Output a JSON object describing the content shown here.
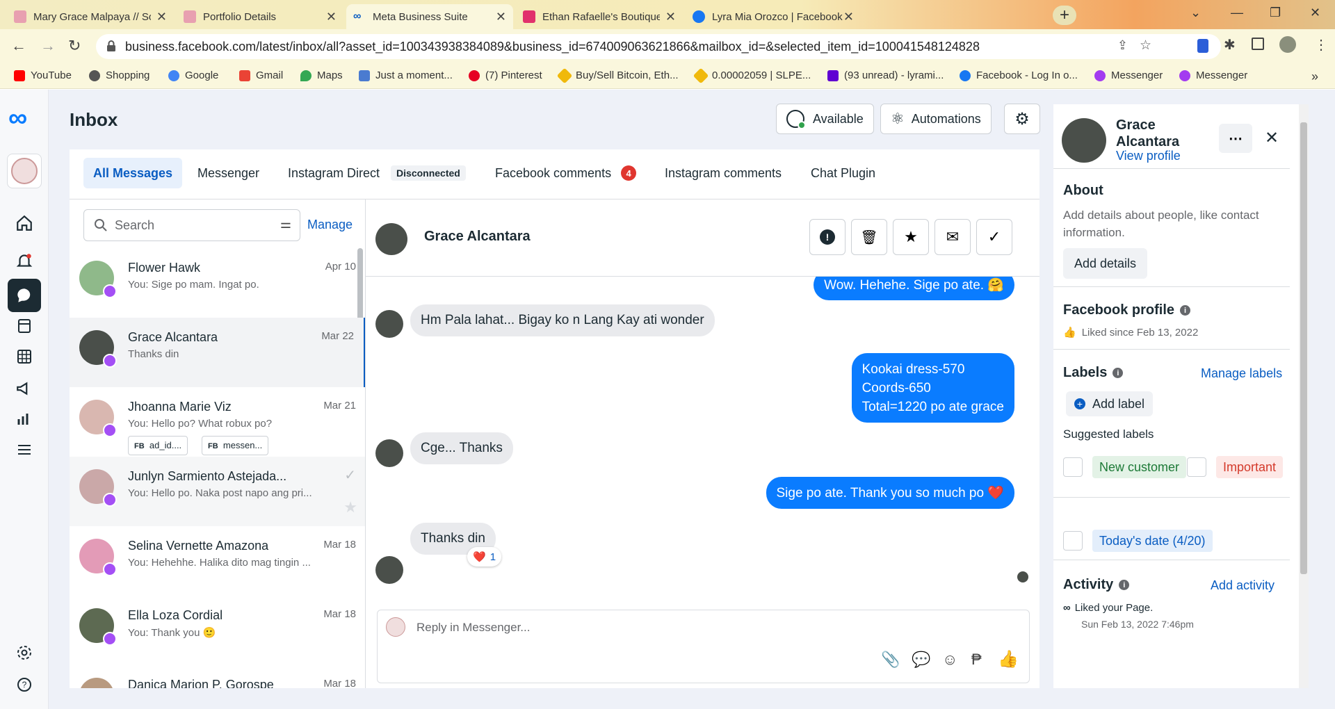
{
  "browser": {
    "tabs": [
      {
        "title": "Mary Grace Malpaya // Social Me",
        "fav": "#e8a0b0"
      },
      {
        "title": "Portfolio Details",
        "fav": "#e8a0b0"
      },
      {
        "title": "Meta Business Suite",
        "fav": "#0a5dc2"
      },
      {
        "title": "Ethan Rafaelle's Boutique (@etha",
        "fav": "#e1306c"
      },
      {
        "title": "Lyra Mia Orozco | Facebook",
        "fav": "#1877f2"
      }
    ],
    "url": "business.facebook.com/latest/inbox/all?asset_id=100343938384089&business_id=674009063621866&mailbox_id=&selected_item_id=100041548124828",
    "bookmarks": [
      "YouTube",
      "Shopping",
      "Google",
      "Gmail",
      "Maps",
      "Just a moment...",
      "(7) Pinterest",
      "Buy/Sell Bitcoin, Eth...",
      "0.00002059 | SLPE...",
      "(93 unread) - lyrami...",
      "Facebook - Log In o...",
      "Messenger",
      "Messenger"
    ]
  },
  "header": {
    "title": "Inbox",
    "available": "Available",
    "automations": "Automations"
  },
  "tabs": {
    "all": "All Messages",
    "messenger": "Messenger",
    "instagram_direct": "Instagram Direct",
    "disconnected": "Disconnected",
    "fb_comments": "Facebook comments",
    "fb_comments_count": "4",
    "ig_comments": "Instagram comments",
    "chat_plugin": "Chat Plugin"
  },
  "list": {
    "search_placeholder": "Search",
    "manage": "Manage",
    "conversations": [
      {
        "name": "Flower Hawk",
        "preview": "You: Sige po mam. Ingat po.",
        "date": "Apr 10"
      },
      {
        "name": "Grace Alcantara",
        "preview": "Thanks din",
        "date": "Mar 22"
      },
      {
        "name": "Jhoanna Marie Viz",
        "preview": "You: Hello po? What robux po?",
        "date": "Mar 21",
        "tags": [
          "ad_id....",
          "messen..."
        ]
      },
      {
        "name": "Junlyn Sarmiento Astejada...",
        "preview": "You: Hello po. Naka post napo ang pri...",
        "date": ""
      },
      {
        "name": "Selina Vernette Amazona",
        "preview": "You: Hehehhe. Halika dito mag tingin ...",
        "date": "Mar 18"
      },
      {
        "name": "Ella Loza Cordial",
        "preview": "You: Thank you 🙂",
        "date": "Mar 18"
      },
      {
        "name": "Danica Marion P. Gorospe",
        "preview": "",
        "date": "Mar 18"
      }
    ]
  },
  "chat": {
    "name": "Grace Alcantara",
    "messages": [
      {
        "text": "Wow. Hehehe. Sige po ate. 🤗",
        "dir": "out"
      },
      {
        "text": "Hm Pala lahat... Bigay ko n Lang Kay ati wonder",
        "dir": "in"
      },
      {
        "lines": [
          "Kookai dress-570",
          "Coords-650",
          "Total=1220 po ate grace"
        ],
        "dir": "out"
      },
      {
        "text": "Cge... Thanks",
        "dir": "in"
      },
      {
        "text": "Sige po ate. Thank you so much po ❤️",
        "dir": "out"
      },
      {
        "text": "Thanks din",
        "dir": "in",
        "reaction": "❤️",
        "reaction_count": "1"
      }
    ],
    "reply_placeholder": "Reply in Messenger..."
  },
  "profile": {
    "name": "Grace Alcantara",
    "view_profile": "View profile",
    "about_title": "About",
    "about_text": "Add details about people, like contact information.",
    "add_details": "Add details",
    "fb_profile_title": "Facebook profile",
    "liked_since": "Liked since Feb 13, 2022",
    "labels_title": "Labels",
    "manage_labels": "Manage labels",
    "add_label": "Add label",
    "suggested": "Suggested labels",
    "label_new": "New customer",
    "label_important": "Important",
    "label_date": "Today's date (4/20)",
    "activity_title": "Activity",
    "add_activity": "Add activity",
    "activity_text": "Liked your Page.",
    "activity_time": "Sun Feb 13, 2022 7:46pm"
  }
}
